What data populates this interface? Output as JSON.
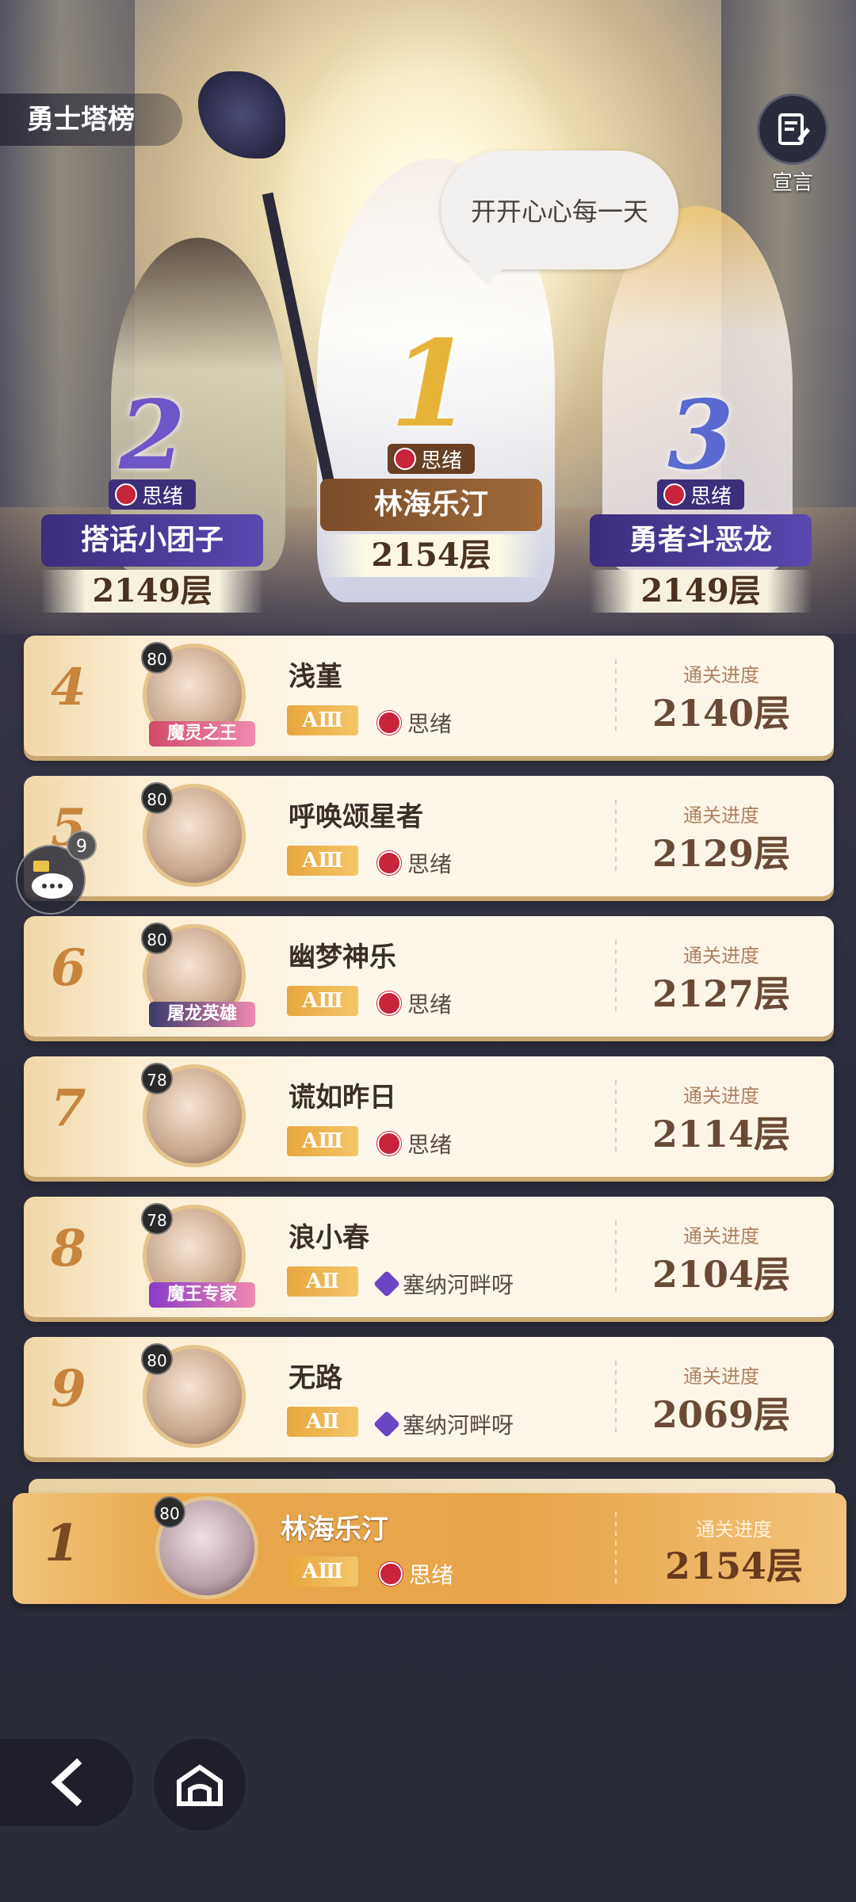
{
  "header": {
    "title": "勇士塔榜",
    "declare_label": "宣言"
  },
  "speech_bubble": "开开心心每一天",
  "podium": [
    {
      "rank": "2",
      "guild": "思绪",
      "name": "搭话小团子",
      "floor": "2149层"
    },
    {
      "rank": "1",
      "guild": "思绪",
      "name": "林海乐汀",
      "floor": "2154层"
    },
    {
      "rank": "3",
      "guild": "思绪",
      "name": "勇者斗恶龙",
      "floor": "2149层"
    }
  ],
  "progress_label": "通关进度",
  "rows": [
    {
      "rank": "4",
      "level": "80",
      "avatar_title": "魔灵之王",
      "name": "浅堇",
      "grade": "AⅢ",
      "guild": "思绪",
      "guild_icon": "rose",
      "floor": "2140层"
    },
    {
      "rank": "5",
      "level": "80",
      "avatar_title": "",
      "name": "呼唤颂星者",
      "grade": "AⅢ",
      "guild": "思绪",
      "guild_icon": "rose",
      "floor": "2129层"
    },
    {
      "rank": "6",
      "level": "80",
      "avatar_title": "屠龙英雄",
      "name": "幽梦神乐",
      "grade": "AⅢ",
      "guild": "思绪",
      "guild_icon": "rose",
      "floor": "2127层"
    },
    {
      "rank": "7",
      "level": "78",
      "avatar_title": "",
      "name": "谎如昨日",
      "grade": "AⅢ",
      "guild": "思绪",
      "guild_icon": "rose",
      "floor": "2114层"
    },
    {
      "rank": "8",
      "level": "78",
      "avatar_title": "魔王专家",
      "name": "浪小春",
      "grade": "AⅡ",
      "guild": "塞纳河畔呀",
      "guild_icon": "diamond",
      "floor": "2104层"
    },
    {
      "rank": "9",
      "level": "80",
      "avatar_title": "",
      "name": "无路",
      "grade": "AⅡ",
      "guild": "塞纳河畔呀",
      "guild_icon": "diamond",
      "floor": "2069层"
    }
  ],
  "self": {
    "rank": "1",
    "level": "80",
    "name": "林海乐汀",
    "grade": "AⅢ",
    "guild": "思绪",
    "floor": "2154层"
  },
  "chat_count": "9",
  "colors": {
    "gold": "#c8843c",
    "rose": "#c8243a",
    "purple_plate": "#4b3a8e",
    "gold_plate": "#8a5a2e"
  }
}
